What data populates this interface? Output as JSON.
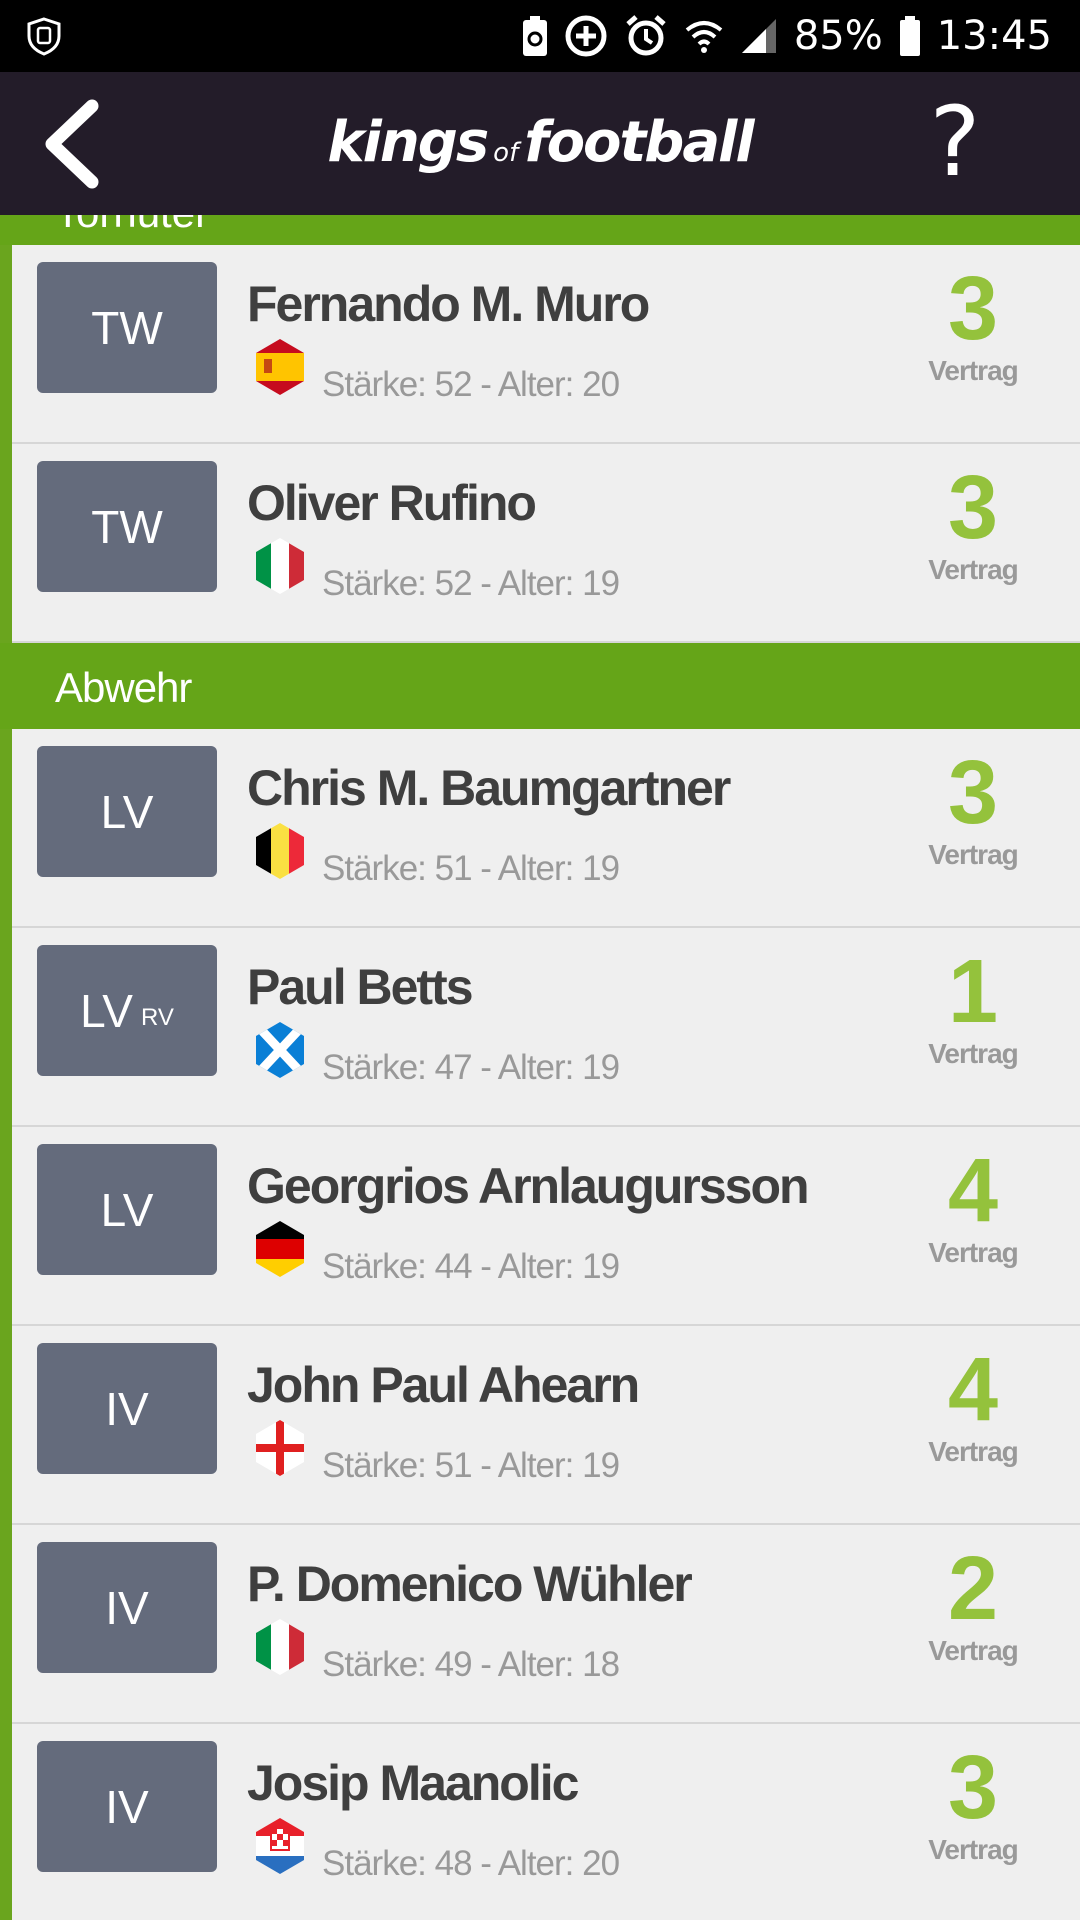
{
  "status_bar": {
    "battery": "85%",
    "time": "13:45",
    "icons": [
      "shield-icon",
      "battery-saver-icon",
      "data-saver-icon",
      "alarm-icon",
      "wifi-icon",
      "signal-icon",
      "battery-icon"
    ]
  },
  "header": {
    "logo_part1": "kings",
    "logo_part2": "of",
    "logo_part3": "football",
    "help_label": "?",
    "background": "#231c29"
  },
  "colors": {
    "accent_green": "#65a518",
    "contract_green": "#94c23c",
    "badge": "#646b7c",
    "name_text": "#3f3f3f",
    "muted_text": "#999999"
  },
  "sections": [
    {
      "title": "Torhüter",
      "players": [
        {
          "pos": "TW",
          "pos2": "",
          "name": "Fernando M. Muro",
          "flag": "es",
          "stats": "Stärke: 52 - Alter: 20",
          "years": "3",
          "contract_label": "Vertrag"
        },
        {
          "pos": "TW",
          "pos2": "",
          "name": "Oliver Rufino",
          "flag": "it",
          "stats": "Stärke: 52 - Alter: 19",
          "years": "3",
          "contract_label": "Vertrag"
        }
      ]
    },
    {
      "title": "Abwehr",
      "players": [
        {
          "pos": "LV",
          "pos2": "",
          "name": "Chris M. Baumgartner",
          "flag": "be",
          "stats": "Stärke: 51 - Alter: 19",
          "years": "3",
          "contract_label": "Vertrag"
        },
        {
          "pos": "LV",
          "pos2": "RV",
          "name": "Paul Betts",
          "flag": "sco",
          "stats": "Stärke: 47 - Alter: 19",
          "years": "1",
          "contract_label": "Vertrag"
        },
        {
          "pos": "LV",
          "pos2": "",
          "name": "Georgrios Arnlaugursson",
          "flag": "de",
          "stats": "Stärke: 44 - Alter: 19",
          "years": "4",
          "contract_label": "Vertrag"
        },
        {
          "pos": "IV",
          "pos2": "",
          "name": "John Paul Ahearn",
          "flag": "eng",
          "stats": "Stärke: 51 - Alter: 19",
          "years": "4",
          "contract_label": "Vertrag"
        },
        {
          "pos": "IV",
          "pos2": "",
          "name": "P. Domenico Wühler",
          "flag": "it",
          "stats": "Stärke: 49 - Alter: 18",
          "years": "2",
          "contract_label": "Vertrag"
        },
        {
          "pos": "IV",
          "pos2": "",
          "name": "Josip Maanolic",
          "flag": "hr",
          "stats": "Stärke: 48 - Alter: 20",
          "years": "3",
          "contract_label": "Vertrag"
        }
      ]
    }
  ]
}
